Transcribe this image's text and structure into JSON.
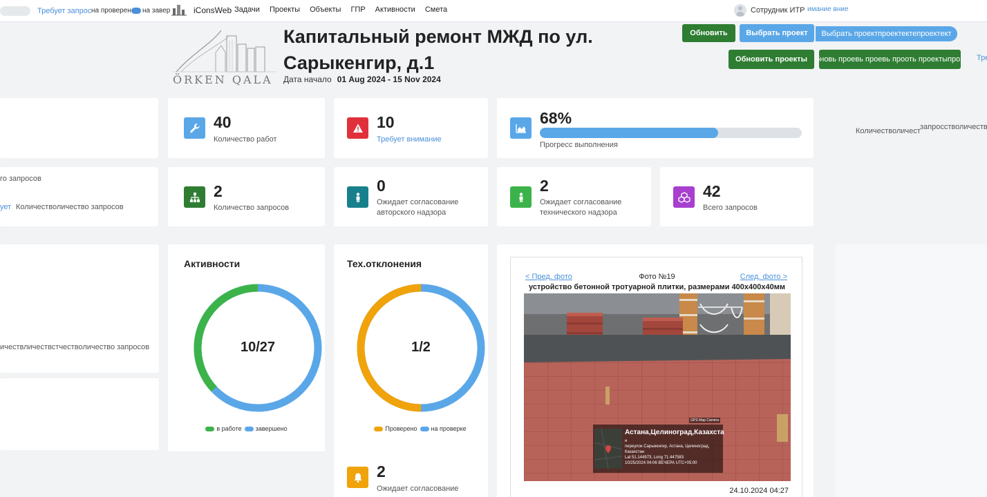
{
  "nav": {
    "ghost_left": "Требует запрос",
    "ghost_checked": "на проверено",
    "ghost_done": "на завер",
    "brand": "iConsWeb",
    "items": [
      "Задачи",
      "Проекты",
      "Объекты",
      "ГПР",
      "Активности",
      "Смета"
    ],
    "user_name": "Сотрудник ИТР",
    "user_ghost": "имание вние"
  },
  "header": {
    "logo_text": "ÖRKEN QALA",
    "title": "Капитальный ремонт МЖД по ул. Сарыкенгир, д.1",
    "dates_label": "Дата начало",
    "dates_value": "01 Aug 2024 - 15 Nov 2024",
    "btn_refresh": "Обновить",
    "btn_select": "Выбрать проект",
    "btn_select_ghost": "Выбрать проектпроектектепроектект",
    "btn_refresh_projects": "Обновить проекты",
    "btn_refresh_ghost": "бновь проевь проевь прооть проектыпров",
    "right_ghost": "Тре"
  },
  "stats": {
    "works_count": "40",
    "works_label": "Количество работ",
    "attention_count": "10",
    "attention_label": "Требует внимание",
    "progress_value": "68%",
    "progress_fraction": 0.68,
    "progress_label": "Прогресс выполнения",
    "ghost_right_1": "Количестволичест",
    "ghost_right_2": "запросстволичество",
    "requests_count": "2",
    "requests_label": "Количество запросов",
    "author_count": "0",
    "author_label": "Ожидает согласование авторского надзора",
    "tech_count": "2",
    "tech_label": "Ожидает согласование технического надзора",
    "total_count": "42",
    "total_label": "Всего запросов",
    "ghost_left_1": "го запросов",
    "ghost_left_2a": "ует",
    "ghost_left_2b": "Количестволичество запросов",
    "ghost_left_3": "ичествличествстчестволичество запросов"
  },
  "charts": {
    "activities": {
      "title": "Активности",
      "center": "10/27",
      "done": 10,
      "total": 27,
      "legend_in_work": "в работе",
      "legend_done": "завершено",
      "color_primary": "#3cb34a",
      "color_secondary": "#5aa7e8"
    },
    "deviations": {
      "title": "Тех.отклонения",
      "center": "1/2",
      "done": 1,
      "total": 2,
      "legend_checked": "Проверено",
      "legend_on_check": "на проверке",
      "color_primary": "#f0a30a",
      "color_secondary": "#5aa7e8"
    },
    "bell": {
      "count": "2",
      "label": "Ожидает согласование"
    }
  },
  "photo": {
    "prev": "< Пред. фото",
    "next": "След. фото >",
    "number": "Фото №19",
    "caption": "устройство бетонной тротуарной плитки, размерами 400x400x40мм",
    "date": "24.10.2024 04:27",
    "gps_camera": "GPS Map Camera",
    "gps_title": "Астана,Целиноград,Казахста",
    "gps_line1": "н",
    "gps_line2": "переулок Сарыкенгир, Астана, Целиноград,",
    "gps_line3": "Казахстан",
    "gps_line4": "Lat 51.144973, Long 71.447583",
    "gps_line5": "10/25/2024 04:06 ВЕЧЕРА UTC+05:00"
  },
  "colors": {
    "accent_blue": "#5aa7e8",
    "link_blue": "#4a90d9",
    "green_button": "#2e7d32",
    "icon_works": "#5aa7e8",
    "icon_attention": "#e0313b",
    "icon_progress": "#5aa7e8",
    "icon_requests": "#2e7d32",
    "icon_author": "#17808c",
    "icon_tech": "#3cb34a",
    "icon_total": "#a83fcf",
    "icon_bell": "#f0a30a"
  }
}
